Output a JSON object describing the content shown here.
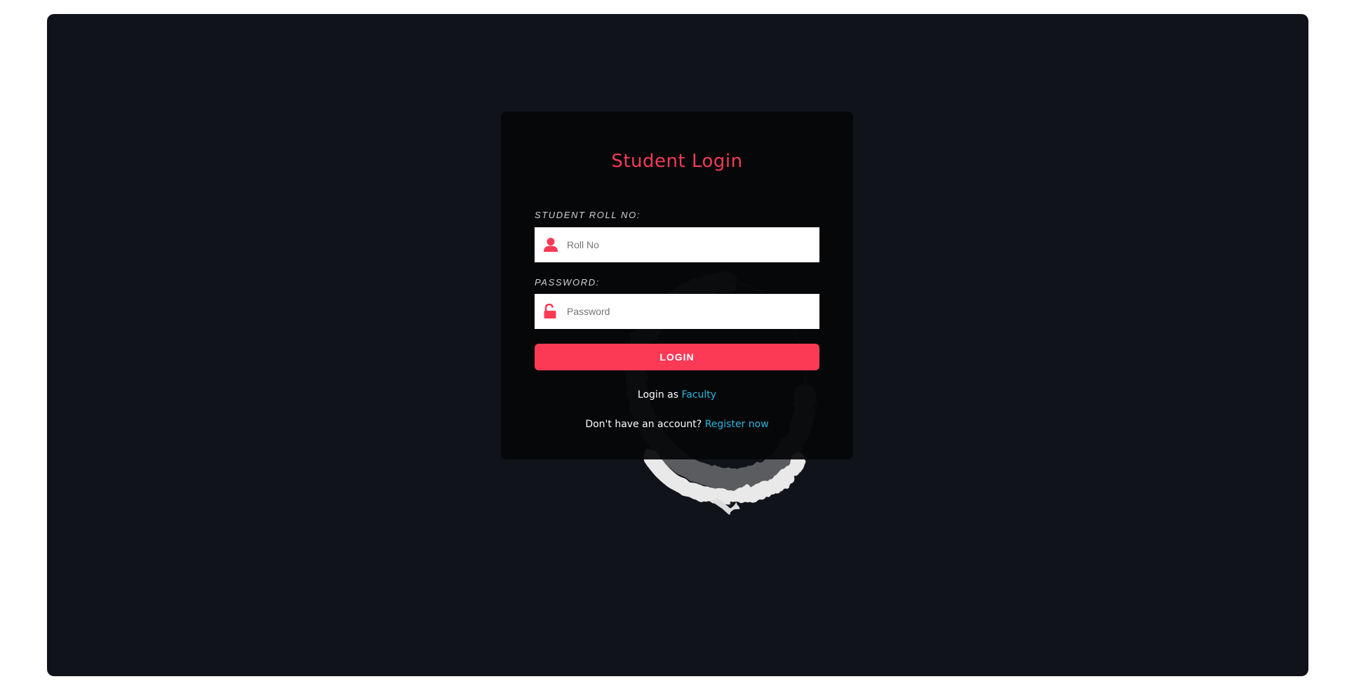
{
  "login": {
    "title": "Student Login",
    "roll_label": "STUDENT ROLL NO:",
    "roll_placeholder": "Roll No",
    "roll_value": "",
    "password_label": "PASSWORD:",
    "password_placeholder": "Password",
    "password_value": "",
    "button_label": "LOGIN",
    "faculty_prefix": "Login as ",
    "faculty_link": "Faculty",
    "register_prefix": "Don't have an account? ",
    "register_link": "Register now"
  },
  "icons": {
    "roll": "user-icon",
    "password": "unlock-icon",
    "background": "brush-circle-decoration"
  },
  "colors": {
    "accent": "#fc3a56",
    "title": "#f03b57",
    "link": "#2ab6e0",
    "background": "#10141a",
    "card": "#050608"
  }
}
